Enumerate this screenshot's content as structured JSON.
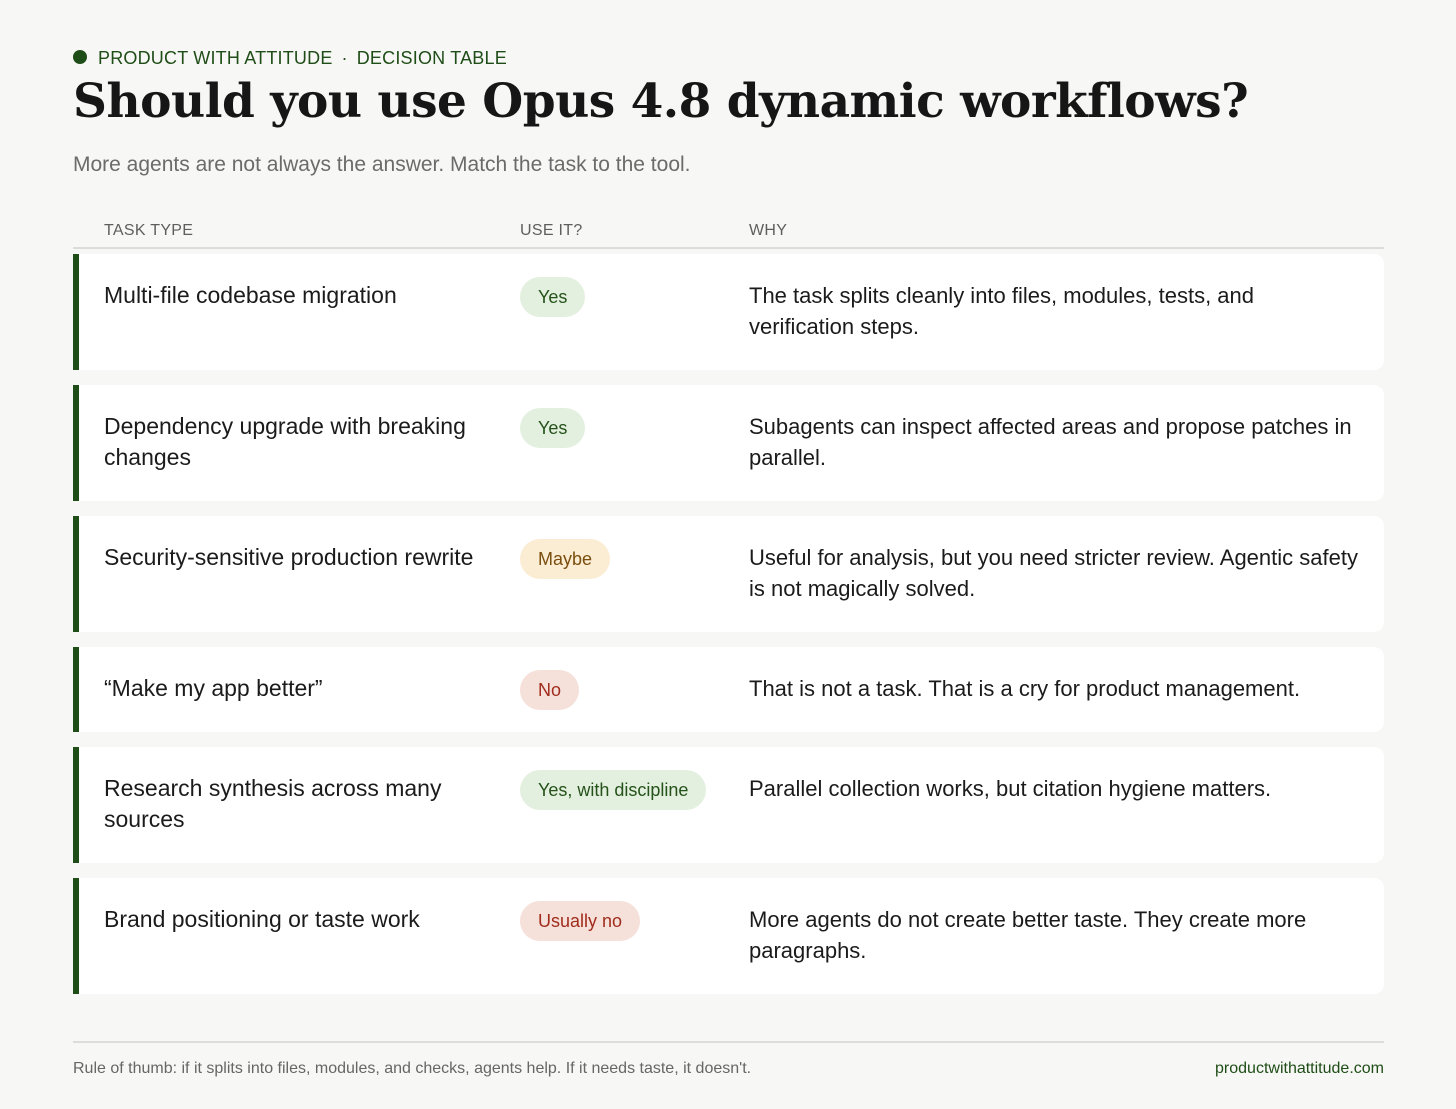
{
  "header": {
    "brand": "PRODUCT WITH ATTITUDE",
    "separator": "·",
    "section": "DECISION TABLE",
    "title": "Should you use Opus 4.8 dynamic workflows?",
    "subtitle": "More agents are not always the answer. Match the task to the tool."
  },
  "table": {
    "columns": [
      "TASK TYPE",
      "USE IT?",
      "WHY"
    ],
    "rows": [
      {
        "task": "Multi-file codebase migration",
        "use": "Yes",
        "use_kind": "yes",
        "why": "The task splits cleanly into files, modules, tests, and verification steps."
      },
      {
        "task": "Dependency upgrade with breaking changes",
        "use": "Yes",
        "use_kind": "yes",
        "why": "Subagents can inspect affected areas and propose patches in parallel."
      },
      {
        "task": "Security-sensitive production rewrite",
        "use": "Maybe",
        "use_kind": "maybe",
        "why": "Useful for analysis, but you need stricter review. Agentic safety is not magically solved."
      },
      {
        "task": "“Make my app better”",
        "use": "No",
        "use_kind": "no",
        "why": "That is not a task. That is a cry for product management."
      },
      {
        "task": "Research synthesis across many sources",
        "use": "Yes, with discipline",
        "use_kind": "yes",
        "why": "Parallel collection works, but citation hygiene matters."
      },
      {
        "task": "Brand positioning or taste work",
        "use": "Usually no",
        "use_kind": "no",
        "why": "More agents do not create better taste. They create more paragraphs."
      }
    ]
  },
  "footer": {
    "note": "Rule of thumb: if it splits into files, modules, and checks, agents help. If it needs taste, it doesn't.",
    "site": "productwithattitude.com"
  },
  "colors": {
    "accent": "#1f4d17",
    "background": "#f7f7f5",
    "yes_bg": "#e4f0df",
    "maybe_bg": "#fbecd4",
    "no_bg": "#f6e0da"
  }
}
